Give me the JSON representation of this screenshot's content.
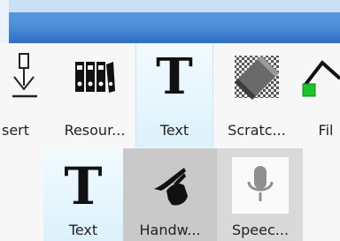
{
  "toolbar": {
    "items": [
      {
        "label": "sert",
        "icon": "insert-icon"
      },
      {
        "label": "Resour...",
        "icon": "binders-icon"
      },
      {
        "label": "Text",
        "icon": "text-icon"
      },
      {
        "label": "Scratc...",
        "icon": "eraser-icon"
      },
      {
        "label": "Fil",
        "icon": "fill-icon"
      }
    ]
  },
  "dropdown": {
    "items": [
      {
        "label": "Text",
        "icon": "text-icon"
      },
      {
        "label": "Handw...",
        "icon": "handwriting-icon"
      },
      {
        "label": "Speec...",
        "icon": "microphone-icon"
      }
    ]
  },
  "glyphs": {
    "text": "T"
  },
  "colors": {
    "selected_bg": "#dcf1fb",
    "title_blue": "#4f8fda",
    "fill_green": "#1fc22a"
  }
}
